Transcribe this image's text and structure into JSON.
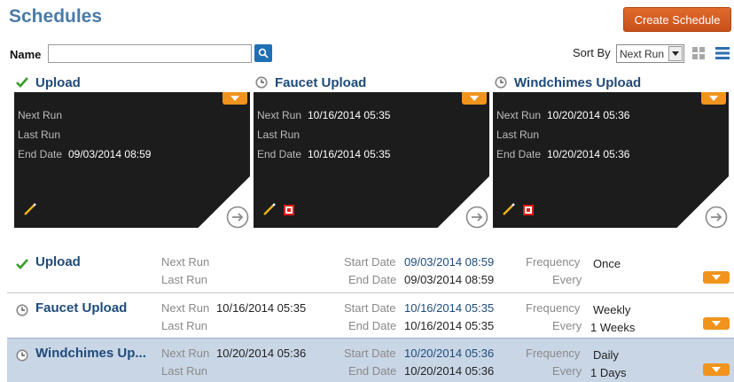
{
  "header": {
    "title": "Schedules",
    "create_label": "Create Schedule"
  },
  "filter": {
    "name_label": "Name",
    "name_value": "",
    "sort_label": "Sort By",
    "sort_value": "Next Run"
  },
  "labels": {
    "next_run": "Next Run",
    "last_run": "Last Run",
    "end_date": "End Date",
    "start_date": "Start Date",
    "frequency": "Frequency",
    "every": "Every"
  },
  "cards": [
    {
      "name": "Upload",
      "status_icon": "check-icon",
      "next_run": "",
      "last_run": "",
      "end_date": "09/03/2014 08:59"
    },
    {
      "name": "Faucet Upload",
      "status_icon": "clock-icon",
      "next_run": "10/16/2014 05:35",
      "last_run": "",
      "end_date": "10/16/2014 05:35"
    },
    {
      "name": "Windchimes Upload",
      "status_icon": "clock-icon",
      "next_run": "10/20/2014 05:36",
      "last_run": "",
      "end_date": "10/20/2014 05:36"
    }
  ],
  "rows": [
    {
      "name": "Upload",
      "status_icon": "check-icon",
      "next_run": "",
      "last_run": "",
      "start_date": "09/03/2014 08:59",
      "end_date": "09/03/2014 08:59",
      "frequency": "Once",
      "every": ""
    },
    {
      "name": "Faucet Upload",
      "status_icon": "clock-icon",
      "next_run": "10/16/2014 05:35",
      "last_run": "",
      "start_date": "10/16/2014 05:35",
      "end_date": "10/16/2014 05:35",
      "frequency": "Weekly",
      "every": "1 Weeks"
    },
    {
      "name": "Windchimes Up...",
      "status_icon": "clock-icon",
      "next_run": "10/20/2014 05:36",
      "last_run": "",
      "start_date": "10/20/2014 05:36",
      "end_date": "10/20/2014 05:36",
      "frequency": "Daily",
      "every": "1 Days"
    }
  ],
  "colors": {
    "accent_orange": "#f0941e",
    "title_blue": "#4a7aa8",
    "card_bg": "#1c1c1c",
    "selected_row": "#c9d6e6"
  }
}
